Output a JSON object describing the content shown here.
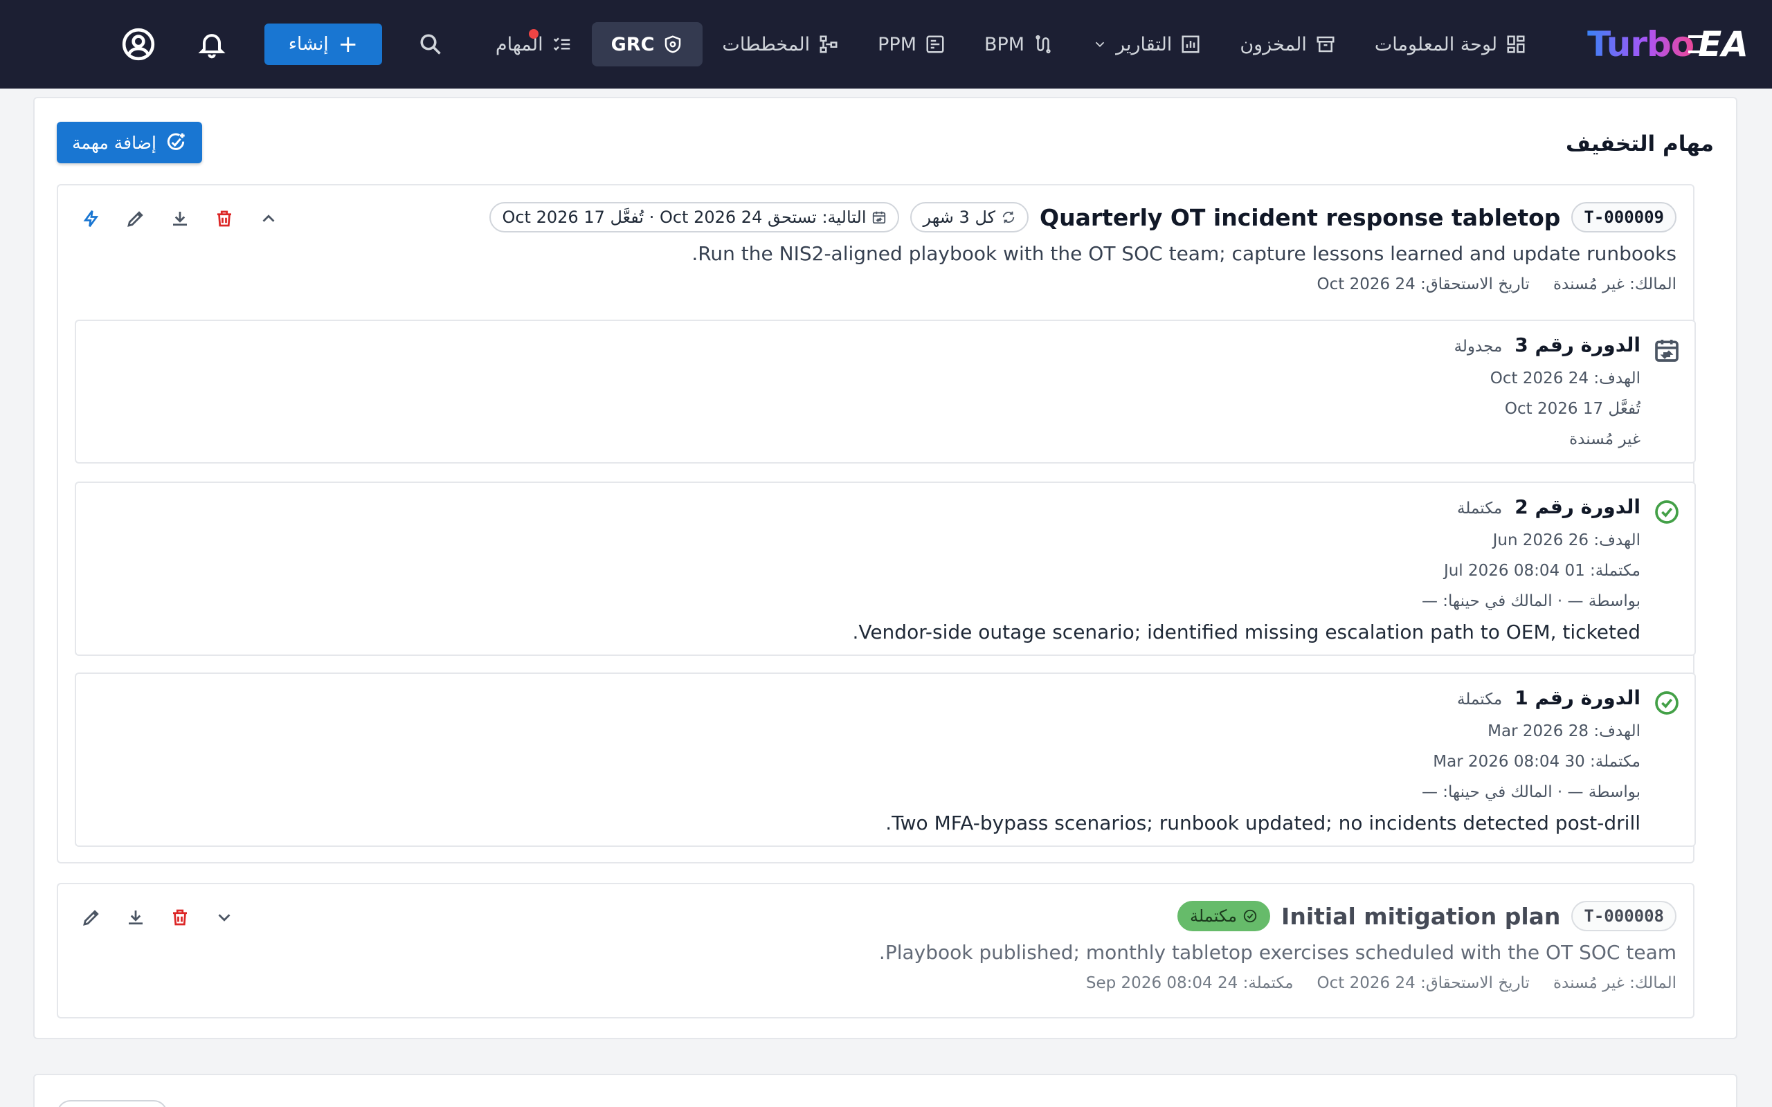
{
  "app": {
    "brand_turbo": "Turbo",
    "brand_ea": "EA"
  },
  "nav": {
    "dashboard": "لوحة المعلومات",
    "inventory": "المخزون",
    "reports": "التقارير",
    "bpm": "BPM",
    "ppm": "PPM",
    "diagrams": "المخططات",
    "grc": "GRC",
    "tasks": "المهام"
  },
  "toolbar": {
    "create_label": "إنشاء",
    "create_plus": "+"
  },
  "panel": {
    "title": "مهام التخفيف",
    "add_task_label": "إضافة مهمة"
  },
  "task1": {
    "id": "T-000009",
    "title": "Quarterly OT incident response tabletop",
    "recurrence": "كل 3 شهر",
    "next": "التالية: تستحق 24 Oct 2026 · تُفعَّل 17 Oct 2026",
    "description": "Run the NIS2-aligned playbook with the OT SOC team; capture lessons learned and update runbooks.",
    "owner": "المالك: غير مُسندة",
    "due": "تاريخ الاستحقاق: 24 Oct 2026",
    "occurrences": [
      {
        "name": "الدورة رقم 3",
        "status": "مجدولة",
        "target": "الهدف: 24 Oct 2026",
        "activates": "تُفعَّل 17 Oct 2026",
        "assignee": "غير مُسندة"
      },
      {
        "name": "الدورة رقم 2",
        "status": "مكتملة",
        "target": "الهدف: 26 Jun 2026",
        "completed": "مكتملة: 01 Jul 2026 08:04",
        "by": "بواسطة — · المالك في حينها: —",
        "note": "Vendor-side outage scenario; identified missing escalation path to OEM, ticketed."
      },
      {
        "name": "الدورة رقم 1",
        "status": "مكتملة",
        "target": "الهدف: 28 Mar 2026",
        "completed": "مكتملة: 30 Mar 2026 08:04",
        "by": "بواسطة — · المالك في حينها: —",
        "note": "Two MFA-bypass scenarios; runbook updated; no incidents detected post-drill."
      }
    ]
  },
  "task2": {
    "id": "T-000008",
    "title": "Initial mitigation plan",
    "status": "مكتملة",
    "description": "Playbook published; monthly tabletop exercises scheduled with the OT SOC team.",
    "owner": "المالك: غير مُسندة",
    "due": "تاريخ الاستحقاق: 24 Oct 2026",
    "completed": "مكتملة: 24 Sep 2026 08:04"
  },
  "colors": {
    "topbar": "#1c1f33",
    "accent": "#1976d2",
    "success": "#66bb6a",
    "danger": "#dc2626"
  }
}
